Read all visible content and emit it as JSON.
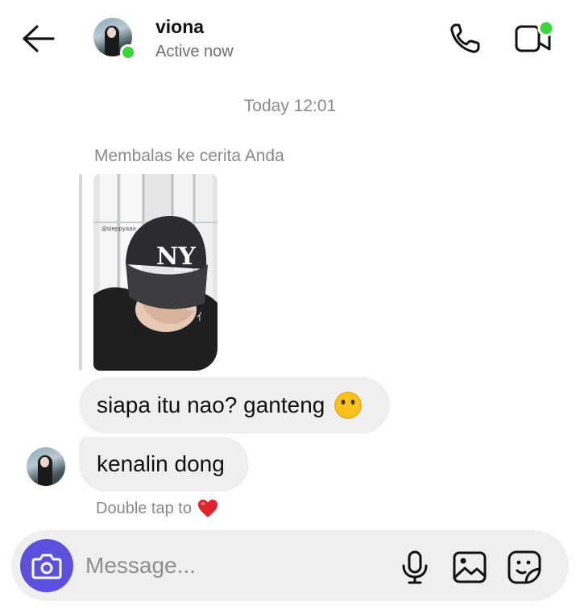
{
  "header": {
    "contact_name": "viona",
    "status": "Active now",
    "icons": {
      "back": "arrow-left-icon",
      "call": "phone-icon",
      "video": "video-camera-icon"
    }
  },
  "thread": {
    "timestamp": "Today 12:01",
    "reply_label": "Membalas ke cerita Anda",
    "messages": [
      {
        "text": "siapa itu nao? ganteng",
        "emoji": "hushed-face-emoji"
      },
      {
        "text": "kenalin dong"
      }
    ],
    "story_thumbnail": {
      "overlay_text": "@sleppyaao_"
    },
    "double_tap_hint": "Double tap to"
  },
  "composer": {
    "placeholder": "Message...",
    "icons": {
      "camera": "camera-icon",
      "mic": "microphone-icon",
      "gallery": "image-icon",
      "sticker": "sticker-icon"
    }
  },
  "colors": {
    "accent": "#5b51de",
    "online": "#3ad53a",
    "bubble": "#efefef",
    "heart": "#e0242e"
  }
}
